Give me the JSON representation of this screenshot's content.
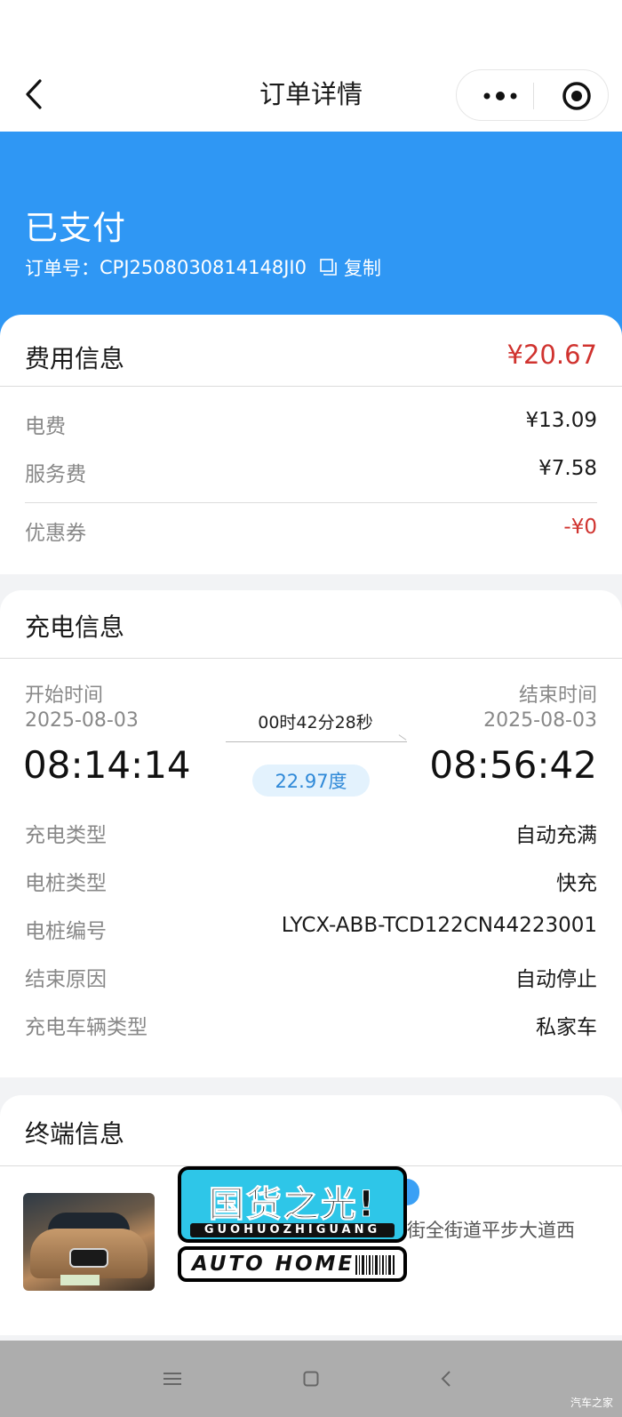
{
  "navbar": {
    "title": "订单详情"
  },
  "status": {
    "text": "已支付",
    "order_label": "订单号：",
    "order_no": "CPJ2508030814148JI0",
    "copy_label": "复制"
  },
  "fee": {
    "title": "费用信息",
    "total": "¥20.67",
    "rows": [
      {
        "label": "电费",
        "value": "¥13.09"
      },
      {
        "label": "服务费",
        "value": "¥7.58"
      }
    ],
    "coupon": {
      "label": "优惠券",
      "value": "-¥0"
    }
  },
  "charge": {
    "title": "充电信息",
    "start_label": "开始时间",
    "start_date": "2025-08-03",
    "start_time": "08:14:14",
    "end_label": "结束时间",
    "end_date": "2025-08-03",
    "end_time": "08:56:42",
    "duration": "00时42分28秒",
    "energy": "22.97度",
    "rows": [
      {
        "label": "充电类型",
        "value": "自动充满"
      },
      {
        "label": "电桩类型",
        "value": "快充"
      },
      {
        "label": "电桩编号",
        "value": "LYCX-ABB-TCD122CN44223001"
      },
      {
        "label": "结束原因",
        "value": "自动停止"
      },
      {
        "label": "充电车辆类型",
        "value": "私家车"
      }
    ]
  },
  "terminal": {
    "title": "终端信息",
    "address_partial": "街全街道平步大道西"
  },
  "watermark": {
    "cn": "国货之光!",
    "pinyin": "GUOHUOZHIGUANG",
    "en": "AUTO HOME"
  },
  "corner": "汽车之家",
  "colors": {
    "header_blue": "#2f97f4",
    "price_red": "#d0332f",
    "pill_bg": "#e3f2fd"
  }
}
